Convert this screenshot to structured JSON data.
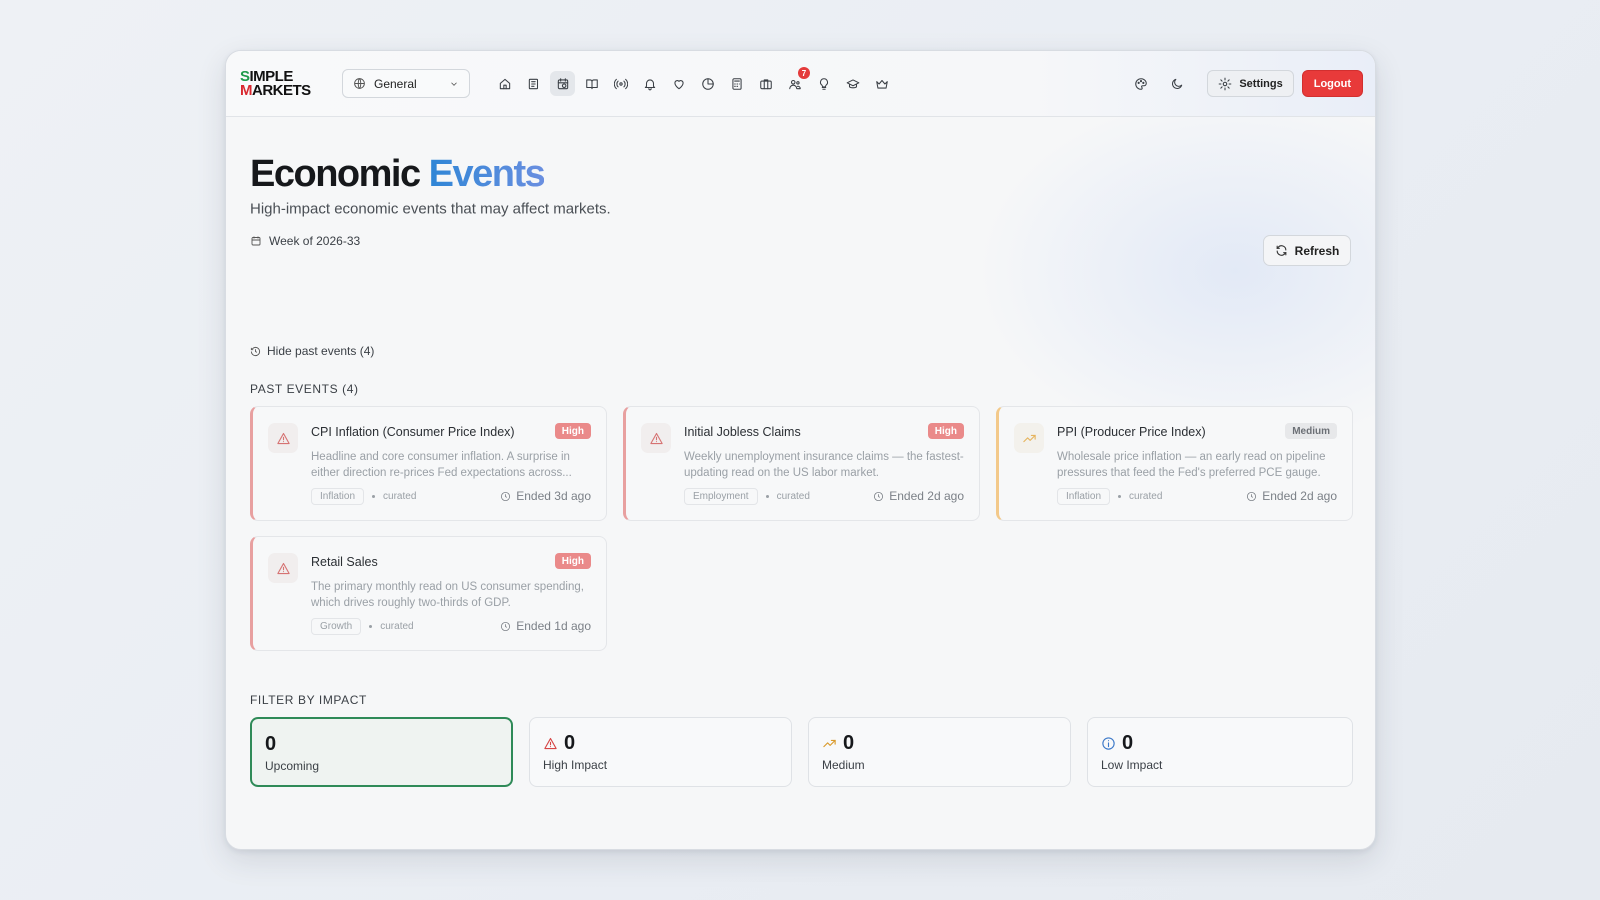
{
  "brand": {
    "line1_s": "S",
    "line1_rest": "IMPLE",
    "line2_m": "M",
    "line2_rest": "ARKETS"
  },
  "workspace": {
    "label": "General"
  },
  "nav": {
    "notifications_badge": "7"
  },
  "header": {
    "settings_label": "Settings",
    "logout_label": "Logout"
  },
  "page": {
    "title_main": "Economic",
    "title_accent": "Events",
    "subtitle": "High-impact economic events that may affect markets.",
    "week": "Week of 2026-33",
    "refresh_label": "Refresh",
    "hide_past": "Hide past events (4)",
    "past_section": "PAST EVENTS (4)",
    "filter_section": "FILTER BY IMPACT"
  },
  "events": [
    {
      "name": "CPI Inflation (Consumer Price Index)",
      "impact": "High",
      "desc": "Headline and core consumer inflation. A surprise in either direction re-prices Fed expectations across...",
      "tag": "Inflation",
      "source": "curated",
      "ended": "Ended 3d ago"
    },
    {
      "name": "Initial Jobless Claims",
      "impact": "High",
      "desc": "Weekly unemployment insurance claims — the fastest-updating read on the US labor market.",
      "tag": "Employment",
      "source": "curated",
      "ended": "Ended 2d ago"
    },
    {
      "name": "PPI (Producer Price Index)",
      "impact": "Medium",
      "desc": "Wholesale price inflation — an early read on pipeline pressures that feed the Fed's preferred PCE gauge.",
      "tag": "Inflation",
      "source": "curated",
      "ended": "Ended 2d ago"
    },
    {
      "name": "Retail Sales",
      "impact": "High",
      "desc": "The primary monthly read on US consumer spending, which drives roughly two-thirds of GDP.",
      "tag": "Growth",
      "source": "curated",
      "ended": "Ended 1d ago"
    }
  ],
  "filters": [
    {
      "count": "0",
      "label": "Upcoming"
    },
    {
      "count": "0",
      "label": "High Impact"
    },
    {
      "count": "0",
      "label": "Medium"
    },
    {
      "count": "0",
      "label": "Low Impact"
    }
  ],
  "colors": {
    "high": "#ea8a8a",
    "medium": "#f3c98a",
    "accent": "#2f86d6",
    "selected": "#2f8a58",
    "logout": "#e83a3a"
  }
}
